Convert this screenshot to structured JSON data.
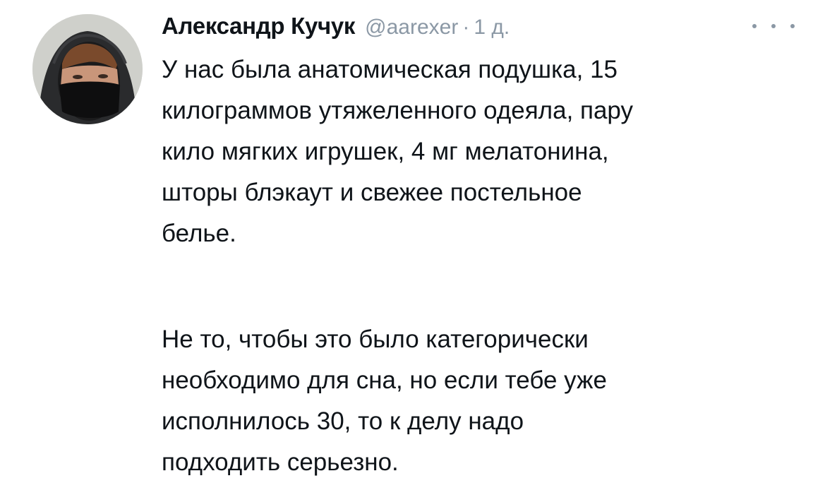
{
  "tweet": {
    "author_name": "Александр Кучук",
    "handle": "@aarexer",
    "separator": "·",
    "time": "1 д.",
    "more_icon": "more-horizontal-icon",
    "paragraph1": [
      "У нас была анатомическая подушка, 15",
      "килограммов утяжеленного одеяла, пару",
      "кило мягких игрушек, 4 мг мелатонина,",
      "шторы блэкаут и свежее постельное",
      "белье."
    ],
    "paragraph2": [
      "Не то, чтобы это было категорически",
      "необходимо для сна, но если тебе уже",
      "исполнилось 30, то к делу надо",
      "подходить серьезно."
    ]
  }
}
